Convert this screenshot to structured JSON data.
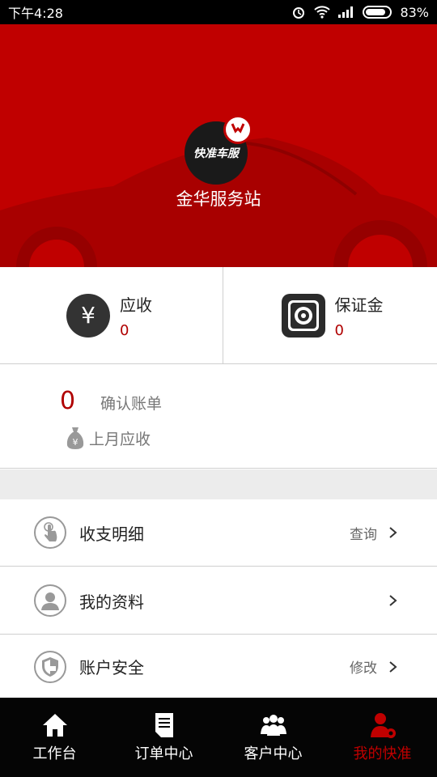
{
  "status_bar": {
    "time": "下午4:28",
    "battery": "83%",
    "battery_level": 0.83
  },
  "header": {
    "logo_text": "快准车服",
    "station_name": "金华服务站"
  },
  "summary": {
    "receivable": {
      "icon": "yen-icon",
      "label": "应收",
      "value": "0"
    },
    "deposit": {
      "icon": "safe-icon",
      "label": "保证金",
      "value": "0"
    }
  },
  "bill": {
    "count": "0",
    "confirm_label": "确认账单",
    "last_month_label": "上月应收"
  },
  "menu": [
    {
      "icon": "touch-icon",
      "label": "收支明细",
      "action": "查询"
    },
    {
      "icon": "user-icon",
      "label": "我的资料",
      "action": ""
    },
    {
      "icon": "shield-icon",
      "label": "账户安全",
      "action": "修改"
    }
  ],
  "nav": [
    {
      "icon": "home-icon",
      "label": "工作台",
      "active": false
    },
    {
      "icon": "document-icon",
      "label": "订单中心",
      "active": false
    },
    {
      "icon": "users-icon",
      "label": "客户中心",
      "active": false
    },
    {
      "icon": "user-gear-icon",
      "label": "我的快准",
      "active": true
    }
  ],
  "colors": {
    "brand_red": "#c00000",
    "value_red": "#b00000"
  }
}
